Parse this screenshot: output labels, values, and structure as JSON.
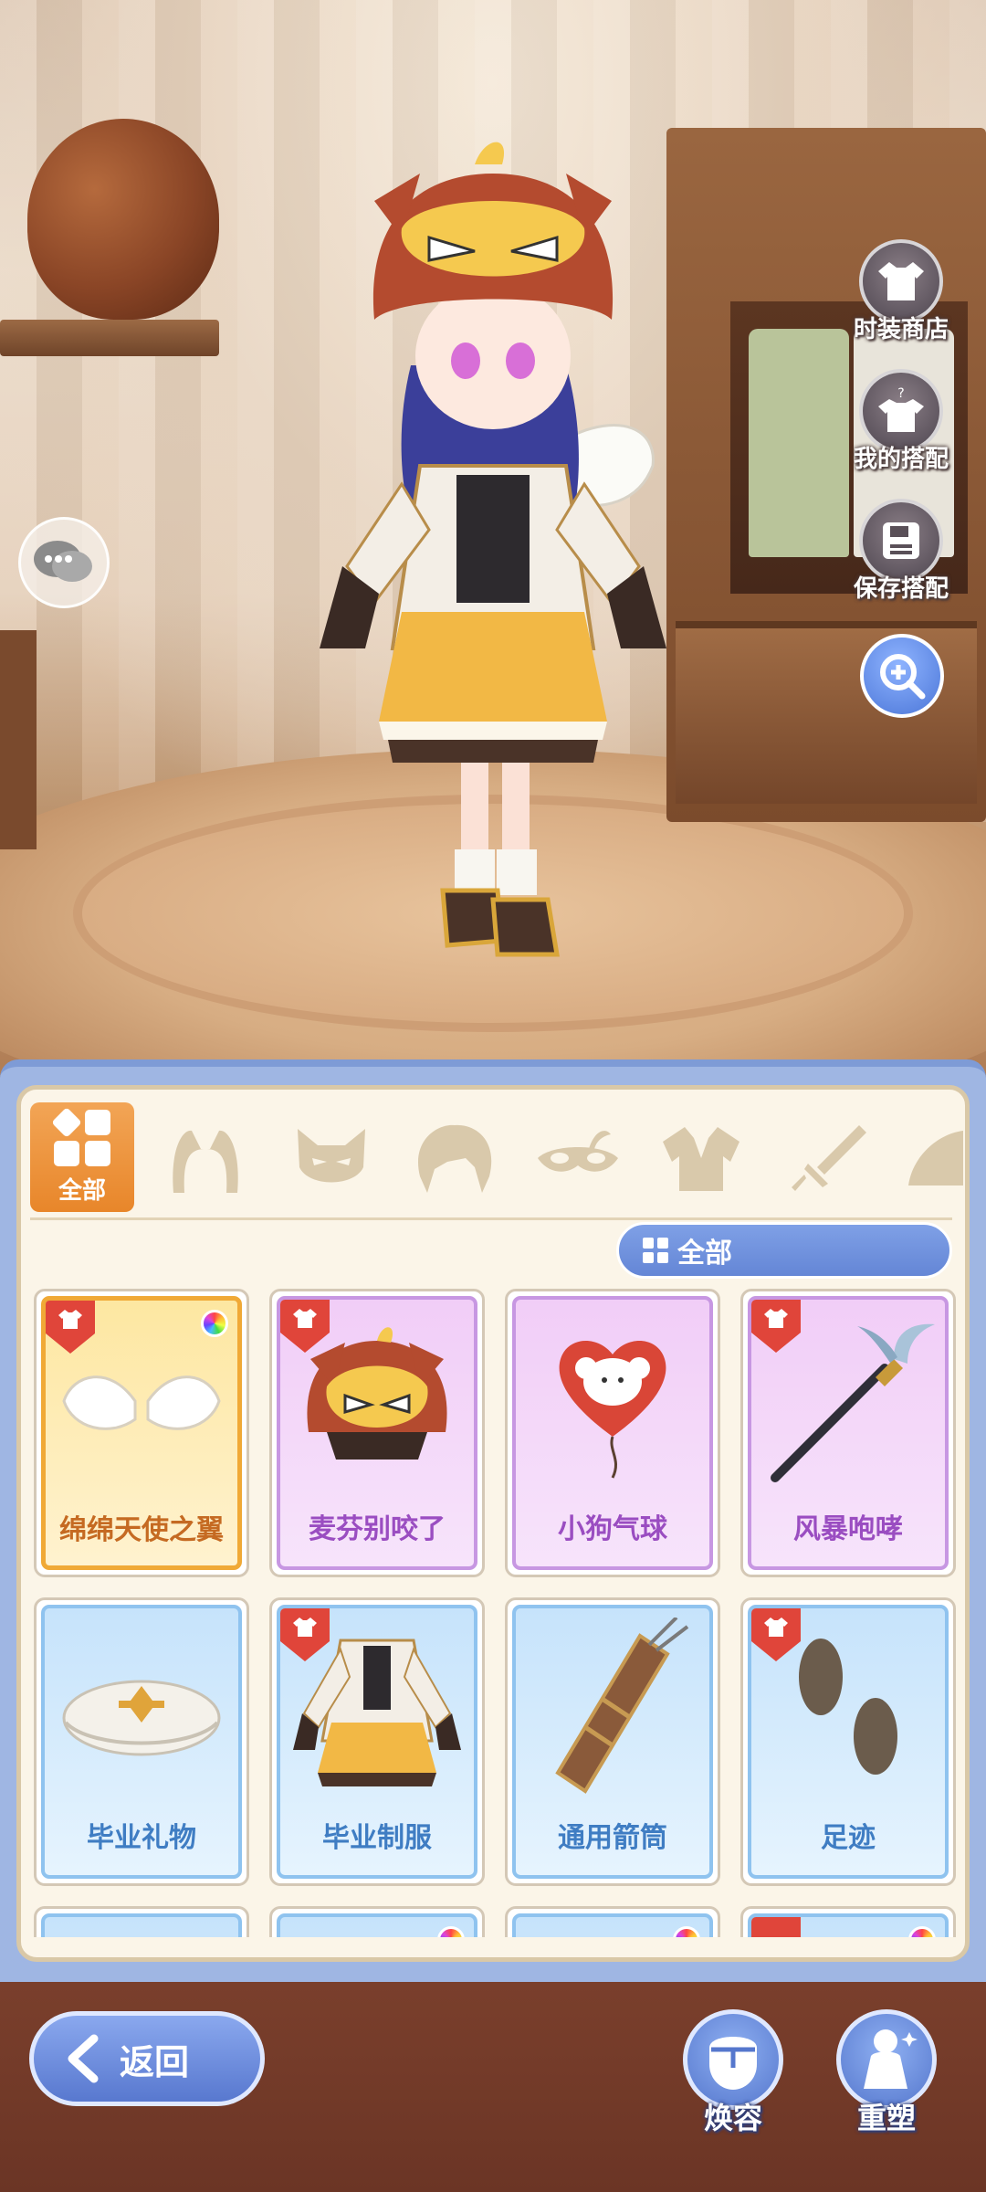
{
  "side_menu": {
    "shop_label": "时装商店",
    "outfits_label": "我的搭配",
    "save_label": "保存搭配"
  },
  "tabs": {
    "all_label": "全部",
    "categories": [
      "ears-icon",
      "mask-icon",
      "hair-icon",
      "eyewear-icon",
      "clothes-icon",
      "weapon-icon",
      "more-icon"
    ]
  },
  "filter": {
    "label": "全部"
  },
  "items": [
    {
      "name": "绵绵天使之翼",
      "rarity": "gold",
      "ribbon": true,
      "rainbow": true,
      "icon": "angel-wings-icon"
    },
    {
      "name": "麦芬别咬了",
      "rarity": "purple",
      "ribbon": true,
      "rainbow": false,
      "icon": "cat-hood-icon"
    },
    {
      "name": "小狗气球",
      "rarity": "purple",
      "ribbon": false,
      "rainbow": false,
      "icon": "dog-balloon-icon"
    },
    {
      "name": "风暴咆哮",
      "rarity": "purple",
      "ribbon": true,
      "rainbow": false,
      "icon": "scythe-staff-icon"
    },
    {
      "name": "毕业礼物",
      "rarity": "blue",
      "ribbon": false,
      "rainbow": false,
      "icon": "beret-icon"
    },
    {
      "name": "毕业制服",
      "rarity": "blue",
      "ribbon": true,
      "rainbow": false,
      "icon": "uniform-icon"
    },
    {
      "name": "通用箭筒",
      "rarity": "blue",
      "ribbon": false,
      "rainbow": false,
      "icon": "quiver-icon"
    },
    {
      "name": "足迹",
      "rarity": "blue",
      "ribbon": true,
      "rainbow": false,
      "icon": "footprints-icon"
    }
  ],
  "bottom": {
    "back_label": "返回",
    "makeover_label": "焕容",
    "reshape_label": "重塑"
  },
  "colors": {
    "accent_orange": "#e8862a",
    "accent_blue": "#6486d6",
    "ribbon_red": "#e0453a"
  }
}
